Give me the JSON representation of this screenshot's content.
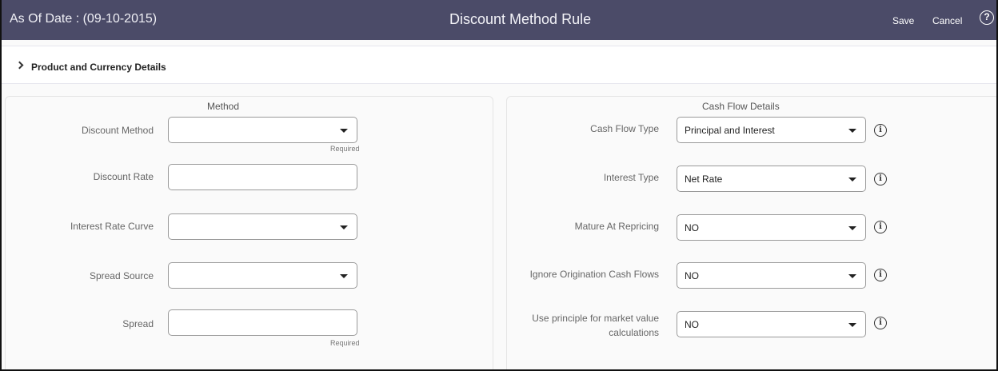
{
  "header": {
    "as_of": "As Of Date : (09-10-2015)",
    "title": "Discount Method Rule",
    "save_label": "Save",
    "cancel_label": "Cancel",
    "help_glyph": "?"
  },
  "section": {
    "label": "Product and Currency Details",
    "icon": "chevron-right-icon"
  },
  "method": {
    "title": "Method",
    "discount_method": {
      "label": "Discount Method",
      "value": "",
      "hint": "Required"
    },
    "discount_rate": {
      "label": "Discount Rate",
      "value": ""
    },
    "interest_rate_curve": {
      "label": "Interest Rate Curve",
      "value": ""
    },
    "spread_source": {
      "label": "Spread Source",
      "value": ""
    },
    "spread": {
      "label": "Spread",
      "value": "",
      "hint": "Required"
    }
  },
  "cash_flow": {
    "title": "Cash Flow Details",
    "info_glyph": "i",
    "cash_flow_type": {
      "label": "Cash Flow Type",
      "value": "Principal and Interest"
    },
    "interest_type": {
      "label": "Interest Type",
      "value": "Net Rate"
    },
    "mature_at_repricing": {
      "label": "Mature At Repricing",
      "value": "NO"
    },
    "ignore_origination": {
      "label": "Ignore Origination Cash Flows",
      "value": "NO"
    },
    "use_principle_line1": "Use principle for market value",
    "use_principle_line2": "calculations",
    "use_principle_value": "NO"
  }
}
